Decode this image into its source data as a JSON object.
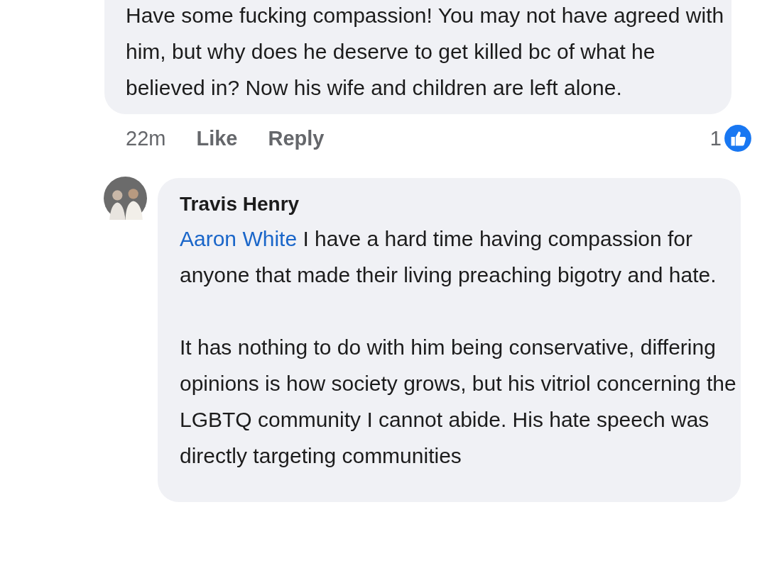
{
  "comments": [
    {
      "text": "Have some fucking compassion! You may not have agreed with him, but why does he deserve to get killed bc of what he believed in? Now his wife and children are left alone.",
      "time": "22m",
      "like": "Like",
      "reply": "Reply",
      "reaction_count": "1"
    },
    {
      "author": "Travis Henry",
      "mention": "Aaron White",
      "paragraphs": [
        "I have a hard time having compassion for anyone that made their living preaching bigotry and hate.",
        "It has nothing to do with him being conservative, differing opinions is how society grows, but his vitriol concerning the LGBTQ community I cannot abide. His hate speech was directly targeting communities"
      ]
    }
  ]
}
